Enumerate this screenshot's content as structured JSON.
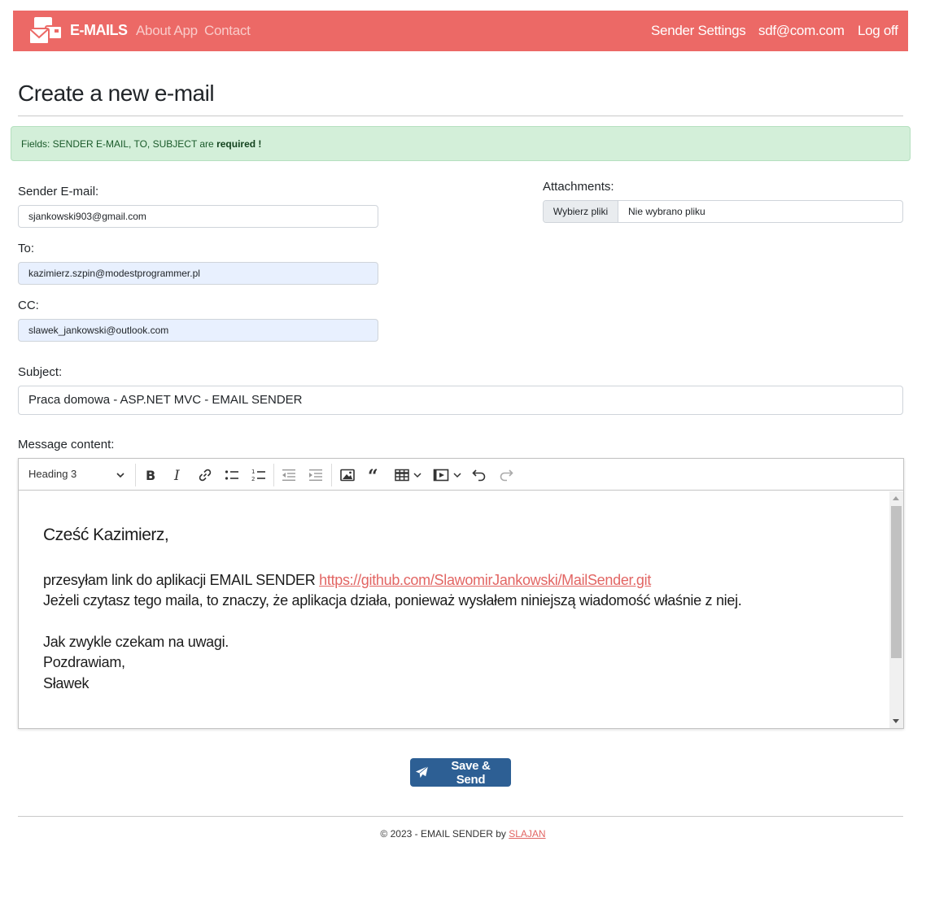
{
  "navbar": {
    "brand": "E-MAILS",
    "links": [
      "About App",
      "Contact"
    ],
    "right": [
      "Sender Settings",
      "sdf@com.com",
      "Log off"
    ],
    "logo_icon": "envelopes-icon",
    "colors": {
      "background": "#ec6966",
      "link_muted": "#f9cbc9",
      "link": "#ffffff"
    }
  },
  "page": {
    "title": "Create a new e-mail"
  },
  "alert": {
    "text": "Fields: SENDER E-MAIL, TO, SUBJECT are",
    "strong": "required !",
    "color": "#d3efd9"
  },
  "form": {
    "sender_label": "Sender E-mail:",
    "sender_value": "sjankowski903@gmail.com",
    "to_label": "To:",
    "to_value": "kazimierz.szpin@modestprogrammer.pl",
    "cc_label": "CC:",
    "cc_value": "slawek_jankowski@outlook.com",
    "attachments_label": "Attachments:",
    "file_button": "Wybierz pliki",
    "file_status": "Nie wybrano pliku",
    "subject_label": "Subject:",
    "subject_value": "Praca domowa - ASP.NET MVC - EMAIL SENDER",
    "message_label": "Message content:"
  },
  "editor": {
    "heading_select": "Heading 3",
    "toolbar_icons": [
      "bold-icon",
      "italic-icon",
      "link-icon",
      "bulleted-list-icon",
      "numbered-list-icon",
      "outdent-icon",
      "indent-icon",
      "image-icon",
      "blockquote-icon",
      "table-icon",
      "media-icon",
      "undo-icon",
      "redo-icon"
    ],
    "heading": "Cześć Kazimierz,",
    "line1_prefix": "przesyłam link do aplikacji EMAIL SENDER ",
    "line1_link": "https://github.com/SlawomirJankowski/MailSender.git",
    "line2": "Jeżeli czytasz tego maila, to znaczy, że aplikacja działa, ponieważ wysłałem niniejszą wiadomość właśnie z niej.",
    "line3": "Jak zwykle czekam na uwagi.",
    "line4": "Pozdrawiam,",
    "line5": "Sławek",
    "link_color": "#e26563"
  },
  "submit": {
    "label": "Save & Send",
    "icon": "paper-plane-icon",
    "color": "#2d5f94"
  },
  "footer": {
    "text": "© 2023 - EMAIL SENDER by ",
    "link": "SLAJAN"
  }
}
